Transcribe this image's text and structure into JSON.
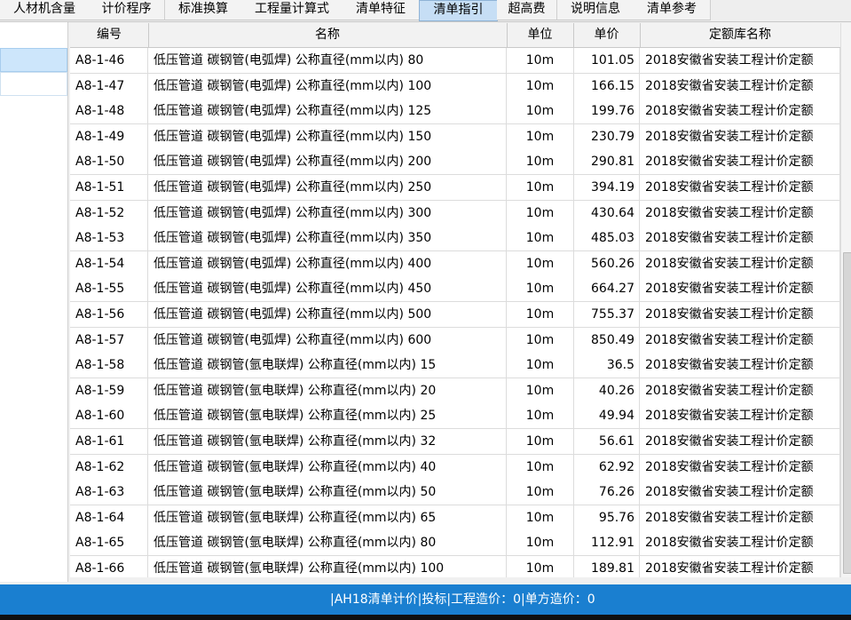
{
  "tabs": [
    {
      "label": "人材机含量"
    },
    {
      "label": "计价程序"
    },
    {
      "label": "标准换算"
    },
    {
      "label": "工程量计算式"
    },
    {
      "label": "清单特征"
    },
    {
      "label": "清单指引"
    },
    {
      "label": "超高费"
    },
    {
      "label": "说明信息"
    },
    {
      "label": "清单参考"
    }
  ],
  "active_tab": "清单指引",
  "table": {
    "headers": {
      "code": "编号",
      "name": "名称",
      "unit": "单位",
      "price": "单价",
      "library": "定额库名称"
    },
    "rows": [
      {
        "code": "A8-1-46",
        "name": "低压管道 碳钢管(电弧焊) 公称直径(mm以内) 80",
        "unit": "10m",
        "price": "101.05",
        "library": "2018安徽省安装工程计价定额"
      },
      {
        "code": "A8-1-47",
        "name": "低压管道 碳钢管(电弧焊) 公称直径(mm以内) 100",
        "unit": "10m",
        "price": "166.15",
        "library": "2018安徽省安装工程计价定额"
      },
      {
        "code": "A8-1-48",
        "name": "低压管道 碳钢管(电弧焊) 公称直径(mm以内) 125",
        "unit": "10m",
        "price": "199.76",
        "library": "2018安徽省安装工程计价定额"
      },
      {
        "code": "A8-1-49",
        "name": "低压管道 碳钢管(电弧焊) 公称直径(mm以内) 150",
        "unit": "10m",
        "price": "230.79",
        "library": "2018安徽省安装工程计价定额"
      },
      {
        "code": "A8-1-50",
        "name": "低压管道 碳钢管(电弧焊) 公称直径(mm以内) 200",
        "unit": "10m",
        "price": "290.81",
        "library": "2018安徽省安装工程计价定额"
      },
      {
        "code": "A8-1-51",
        "name": "低压管道 碳钢管(电弧焊) 公称直径(mm以内) 250",
        "unit": "10m",
        "price": "394.19",
        "library": "2018安徽省安装工程计价定额"
      },
      {
        "code": "A8-1-52",
        "name": "低压管道 碳钢管(电弧焊) 公称直径(mm以内) 300",
        "unit": "10m",
        "price": "430.64",
        "library": "2018安徽省安装工程计价定额"
      },
      {
        "code": "A8-1-53",
        "name": "低压管道 碳钢管(电弧焊) 公称直径(mm以内) 350",
        "unit": "10m",
        "price": "485.03",
        "library": "2018安徽省安装工程计价定额"
      },
      {
        "code": "A8-1-54",
        "name": "低压管道 碳钢管(电弧焊) 公称直径(mm以内) 400",
        "unit": "10m",
        "price": "560.26",
        "library": "2018安徽省安装工程计价定额"
      },
      {
        "code": "A8-1-55",
        "name": "低压管道 碳钢管(电弧焊) 公称直径(mm以内) 450",
        "unit": "10m",
        "price": "664.27",
        "library": "2018安徽省安装工程计价定额"
      },
      {
        "code": "A8-1-56",
        "name": "低压管道 碳钢管(电弧焊) 公称直径(mm以内) 500",
        "unit": "10m",
        "price": "755.37",
        "library": "2018安徽省安装工程计价定额"
      },
      {
        "code": "A8-1-57",
        "name": "低压管道 碳钢管(电弧焊) 公称直径(mm以内) 600",
        "unit": "10m",
        "price": "850.49",
        "library": "2018安徽省安装工程计价定额"
      },
      {
        "code": "A8-1-58",
        "name": "低压管道 碳钢管(氩电联焊) 公称直径(mm以内) 15",
        "unit": "10m",
        "price": "36.5",
        "library": "2018安徽省安装工程计价定额"
      },
      {
        "code": "A8-1-59",
        "name": "低压管道 碳钢管(氩电联焊) 公称直径(mm以内) 20",
        "unit": "10m",
        "price": "40.26",
        "library": "2018安徽省安装工程计价定额"
      },
      {
        "code": "A8-1-60",
        "name": "低压管道 碳钢管(氩电联焊) 公称直径(mm以内) 25",
        "unit": "10m",
        "price": "49.94",
        "library": "2018安徽省安装工程计价定额"
      },
      {
        "code": "A8-1-61",
        "name": "低压管道 碳钢管(氩电联焊) 公称直径(mm以内) 32",
        "unit": "10m",
        "price": "56.61",
        "library": "2018安徽省安装工程计价定额"
      },
      {
        "code": "A8-1-62",
        "name": "低压管道 碳钢管(氩电联焊) 公称直径(mm以内) 40",
        "unit": "10m",
        "price": "62.92",
        "library": "2018安徽省安装工程计价定额"
      },
      {
        "code": "A8-1-63",
        "name": "低压管道 碳钢管(氩电联焊) 公称直径(mm以内) 50",
        "unit": "10m",
        "price": "76.26",
        "library": "2018安徽省安装工程计价定额"
      },
      {
        "code": "A8-1-64",
        "name": "低压管道 碳钢管(氩电联焊) 公称直径(mm以内) 65",
        "unit": "10m",
        "price": "95.76",
        "library": "2018安徽省安装工程计价定额"
      },
      {
        "code": "A8-1-65",
        "name": "低压管道 碳钢管(氩电联焊) 公称直径(mm以内) 80",
        "unit": "10m",
        "price": "112.91",
        "library": "2018安徽省安装工程计价定额"
      },
      {
        "code": "A8-1-66",
        "name": "低压管道 碳钢管(氩电联焊) 公称直径(mm以内) 100",
        "unit": "10m",
        "price": "189.81",
        "library": "2018安徽省安装工程计价定额"
      }
    ]
  },
  "status": {
    "text": "|AH18清单计价|投标|工程造价：0|单方造价：0"
  },
  "colors": {
    "status_bar": "#1a7fd0",
    "active_tab": "#c6def5",
    "selected_row": "#cde6fb"
  }
}
